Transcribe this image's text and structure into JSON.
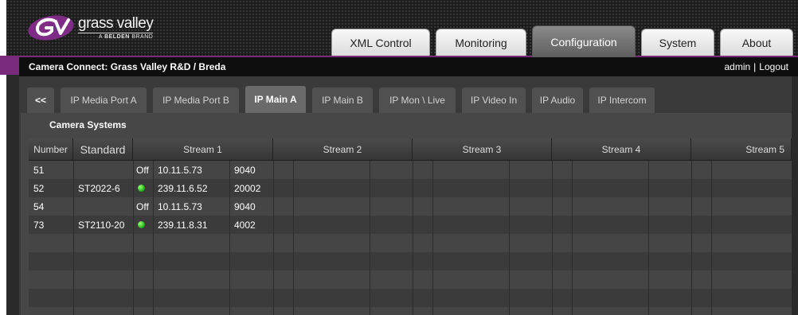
{
  "brand": {
    "name": "grass valley",
    "tagline_prefix": "A",
    "tagline_brand": "BELDEN",
    "tagline_suffix": "BRAND"
  },
  "main_tabs": [
    {
      "label": "XML Control",
      "active": false
    },
    {
      "label": "Monitoring",
      "active": false
    },
    {
      "label": "Configuration",
      "active": true
    },
    {
      "label": "System",
      "active": false
    },
    {
      "label": "About",
      "active": false
    }
  ],
  "title_bar": {
    "title": "Camera Connect: Grass Valley R&D / Breda",
    "user": "admin",
    "separator": "|",
    "logout": "Logout"
  },
  "sub_tabs": [
    {
      "label": "<<"
    },
    {
      "label": "IP Media Port A"
    },
    {
      "label": "IP Media Port B"
    },
    {
      "label": "IP Main A",
      "active": true
    },
    {
      "label": "IP Main B"
    },
    {
      "label": "IP Mon \\ Live"
    },
    {
      "label": "IP Video In"
    },
    {
      "label": "IP Audio"
    },
    {
      "label": "IP Intercom"
    }
  ],
  "panel": {
    "title": "Camera Systems"
  },
  "table": {
    "columns": [
      "Number",
      "Standard",
      "Stream 1",
      "Stream 2",
      "Stream 3",
      "Stream 4",
      "Stream 5"
    ],
    "rows": [
      {
        "number": "51",
        "standard": "",
        "status": "Off",
        "ip": "10.11.5.73",
        "port": "9040"
      },
      {
        "number": "52",
        "standard": "ST2022-6",
        "status": "on",
        "ip": "239.11.6.52",
        "port": "20002"
      },
      {
        "number": "54",
        "standard": "",
        "status": "Off",
        "ip": "10.11.5.73",
        "port": "9040"
      },
      {
        "number": "73",
        "standard": "ST2110-20",
        "status": "on",
        "ip": "239.11.8.31",
        "port": "4002"
      }
    ],
    "empty_rows": 4
  },
  "colors": {
    "accent_purple": "#7a2a7a",
    "status_on": "#23b820"
  }
}
